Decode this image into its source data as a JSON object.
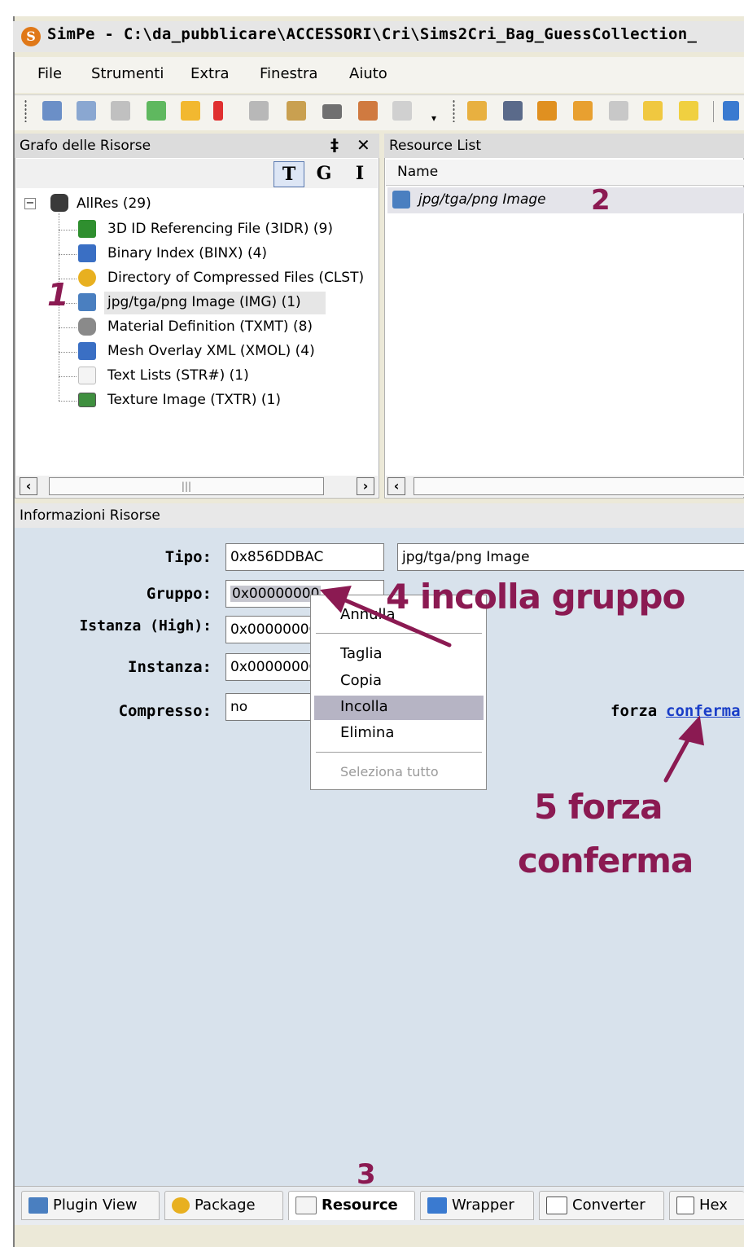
{
  "window": {
    "title": "SimPe - C:\\da_pubblicare\\ACCESSORI\\Cri\\Sims2Cri_Bag_GuessCollection_"
  },
  "menu": [
    "File",
    "Strumenti",
    "Extra",
    "Finestra",
    "Aiuto"
  ],
  "resource_tree": {
    "header": "Grafo delle Risorse",
    "pin_glyph": "‡",
    "close_glyph": "✕",
    "view_buttons": [
      "T",
      "G",
      "I"
    ],
    "root_label": "AllRes (29)",
    "items": [
      {
        "label": "3D ID Referencing File (3IDR) (9)",
        "icon": "3d-id-icon",
        "color": "#2f8f2f"
      },
      {
        "label": "Binary Index (BINX) (4)",
        "icon": "binary-index-icon",
        "color": "#3a6fc4"
      },
      {
        "label": "Directory of Compressed Files (CLST)",
        "icon": "directory-icon",
        "color": "#e8b020"
      },
      {
        "label": "jpg/tga/png Image (IMG) (1)",
        "icon": "image-icon",
        "color": "#4a7fc0"
      },
      {
        "label": "Material Definition (TXMT) (8)",
        "icon": "material-icon",
        "color": "#8a8a8a"
      },
      {
        "label": "Mesh Overlay XML (XMOL) (4)",
        "icon": "mesh-overlay-icon",
        "color": "#3a6fc4"
      },
      {
        "label": "Text Lists (STR#) (1)",
        "icon": "text-list-icon",
        "color": "#bdbdbd"
      },
      {
        "label": "Texture Image (TXTR) (1)",
        "icon": "texture-icon",
        "color": "#3f8f3f"
      }
    ],
    "selected_index": 3
  },
  "resource_list": {
    "header": "Resource List",
    "column": "Name",
    "rows": [
      "jpg/tga/png Image"
    ]
  },
  "info": {
    "header": "Informazioni Risorse",
    "tipo_label": "Tipo:",
    "tipo_value": "0x856DDBAC",
    "tipo_name": "jpg/tga/png Image",
    "gruppo_label": "Gruppo:",
    "gruppo_value": "0x00000000",
    "istanza_high_label": "Istanza (High):",
    "istanza_high_value": "0x0000000C",
    "instanza_label": "Instanza:",
    "instanza_value": "0x0000000C",
    "compresso_label": "Compresso:",
    "compresso_value": "no",
    "forza_text": "forza",
    "conferma_link": "conferma"
  },
  "context_menu": {
    "items": [
      "Annulla",
      "Taglia",
      "Copia",
      "Incolla",
      "Elimina",
      "Seleziona tutto"
    ],
    "highlighted": "Incolla",
    "disabled": [
      "Seleziona tutto"
    ]
  },
  "annotations": {
    "a1": "1",
    "a2": "2",
    "a3": "3",
    "a4": "4 incolla gruppo",
    "a5_line1": "5 forza",
    "a5_line2": "conferma",
    "color": "#8b1a52"
  },
  "bottom_tabs": [
    {
      "label": "Plugin View",
      "icon": "plugin-view-icon"
    },
    {
      "label": "Package",
      "icon": "package-icon"
    },
    {
      "label": "Resource",
      "icon": "resource-icon",
      "active": true
    },
    {
      "label": "Wrapper",
      "icon": "wrapper-icon"
    },
    {
      "label": "Converter",
      "icon": "converter-icon"
    },
    {
      "label": "Hex",
      "icon": "hex-icon"
    }
  ]
}
